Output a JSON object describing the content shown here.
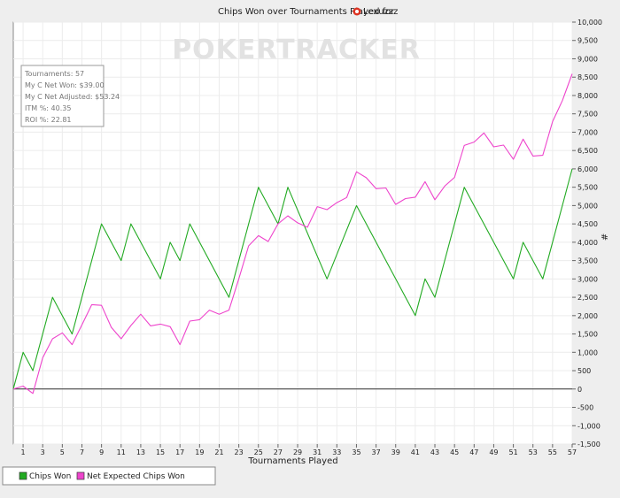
{
  "chart_data": {
    "type": "line",
    "title": "Chips Won over Tournaments Played for",
    "player": "Lexuzzz",
    "xlabel": "Tournaments Played",
    "ylabel": "#",
    "watermark": "POKERTRACKER",
    "x_ticks": [
      1,
      3,
      5,
      7,
      9,
      11,
      13,
      15,
      17,
      19,
      21,
      23,
      25,
      27,
      29,
      31,
      33,
      35,
      37,
      39,
      41,
      43,
      45,
      47,
      49,
      51,
      53,
      55,
      57
    ],
    "y_ticks": [
      -1500,
      -1000,
      -500,
      0,
      500,
      1000,
      1500,
      2000,
      2500,
      3000,
      3500,
      4000,
      4500,
      5000,
      5500,
      6000,
      6500,
      7000,
      7500,
      8000,
      8500,
      9000,
      9500,
      10000
    ],
    "y_tick_labels": [
      "-1,500",
      "-1,000",
      "-500",
      "0",
      "500",
      "1,000",
      "1,500",
      "2,000",
      "2,500",
      "3,000",
      "3,500",
      "4,000",
      "4,500",
      "5,000",
      "5,500",
      "6,000",
      "6,500",
      "7,000",
      "7,500",
      "8,000",
      "8,500",
      "9,000",
      "9,500",
      "10,000"
    ],
    "xlim": [
      0,
      57
    ],
    "ylim": [
      -1500,
      10000
    ],
    "grid": true,
    "legend_position": "bottom-left",
    "stats": [
      "Tournaments: 57",
      "My C Net Won: $39.00",
      "My C Net Adjusted: $53.24",
      "ITM %: 40.35",
      "ROI %: 22.81"
    ],
    "series": [
      {
        "name": "Chips Won",
        "color": "#22aa22",
        "x": [
          0,
          1,
          2,
          4,
          6,
          9,
          11,
          12,
          15,
          16,
          17,
          18,
          22,
          25,
          27,
          28,
          32,
          35,
          41,
          42,
          43,
          46,
          51,
          52,
          54,
          57
        ],
        "values": [
          0,
          1000,
          500,
          2500,
          1500,
          4500,
          3500,
          4500,
          3000,
          4000,
          3500,
          4500,
          2500,
          5500,
          4500,
          5500,
          3000,
          5000,
          2000,
          3000,
          2500,
          5500,
          3000,
          4000,
          3000,
          6000
        ]
      },
      {
        "name": "Net Expected Chips Won",
        "color": "#ee44cc",
        "x": [
          0,
          1,
          2,
          3,
          4,
          5,
          6,
          7,
          8,
          9,
          10,
          11,
          12,
          13,
          14,
          15,
          16,
          17,
          18,
          19,
          20,
          21,
          22,
          23,
          24,
          25,
          26,
          27,
          28,
          29,
          30,
          31,
          32,
          33,
          34,
          35,
          36,
          37,
          38,
          39,
          40,
          41,
          42,
          43,
          44,
          45,
          46,
          47,
          48,
          49,
          50,
          51,
          52,
          53,
          54,
          55,
          56,
          57
        ],
        "values": [
          0,
          80,
          -120,
          850,
          1370,
          1530,
          1210,
          1750,
          2300,
          2280,
          1680,
          1370,
          1730,
          2040,
          1720,
          1770,
          1700,
          1210,
          1850,
          1890,
          2150,
          2040,
          2150,
          3000,
          3900,
          4180,
          4020,
          4500,
          4720,
          4530,
          4410,
          4970,
          4890,
          5080,
          5220,
          5920,
          5760,
          5460,
          5480,
          5030,
          5190,
          5230,
          5650,
          5160,
          5530,
          5770,
          6640,
          6730,
          6980,
          6600,
          6650,
          6260,
          6810,
          6350,
          6370,
          7290,
          7860,
          8590
        ]
      }
    ]
  }
}
